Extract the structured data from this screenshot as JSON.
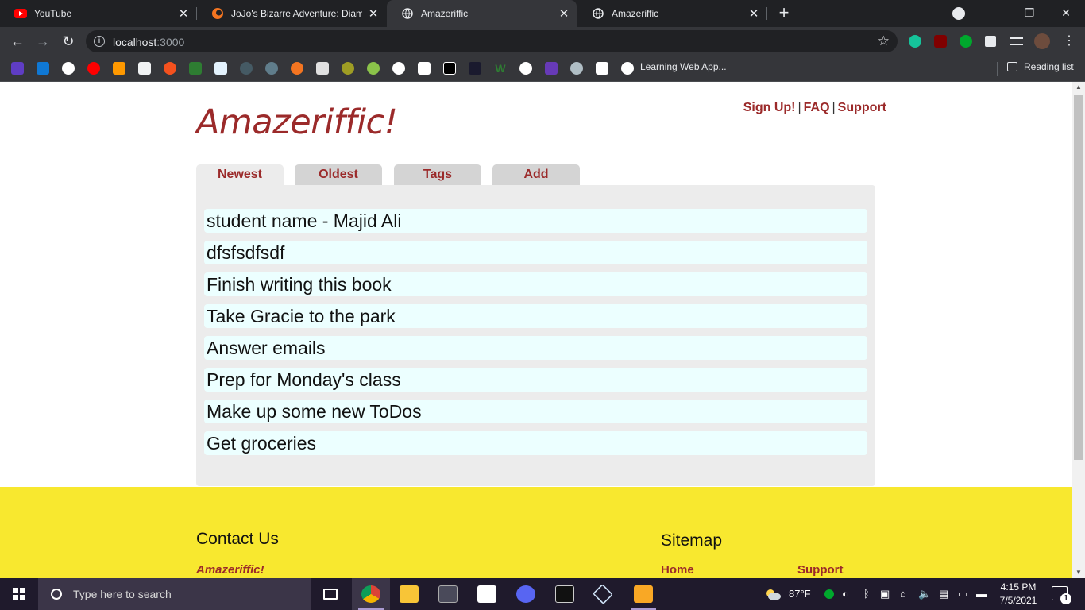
{
  "browser": {
    "tabs": [
      {
        "title": "YouTube",
        "icon": "youtube-icon"
      },
      {
        "title": "JoJo's Bizarre Adventure: Diamond",
        "icon": "crunchyroll-icon"
      },
      {
        "title": "Amazeriffic",
        "icon": "globe-icon",
        "active": true
      },
      {
        "title": "Amazeriffic",
        "icon": "globe-icon"
      }
    ],
    "url_host": "localhost",
    "url_port": ":3000",
    "bookmark_label": "Learning Web App...",
    "reading_list": "Reading list"
  },
  "site": {
    "logo": "Amazeriffic!",
    "links": {
      "signup": "Sign Up!",
      "faq": "FAQ",
      "support": "Support",
      "separator": "|"
    },
    "tabs": [
      "Newest",
      "Oldest",
      "Tags",
      "Add"
    ],
    "active_tab": "Newest",
    "todos": [
      "student name - Majid Ali",
      "dfsfsdfsdf",
      "Finish writing this book",
      "Take Gracie to the park",
      "Answer emails",
      "Prep for Monday's class",
      "Make up some new ToDos",
      "Get groceries"
    ],
    "footer": {
      "contact_heading": "Contact Us",
      "contact_sub": "Amazeriffic!",
      "sitemap_heading": "Sitemap",
      "sitemap_home": "Home",
      "sitemap_support": "Support"
    },
    "colors": {
      "brand": "#9b2a2a",
      "footer_bg": "#f8e82f",
      "panel_bg": "#ececec",
      "todo_bg": "#ecffff"
    }
  },
  "taskbar": {
    "search_placeholder": "Type here to search",
    "weather": "87°F",
    "time": "4:15 PM",
    "date": "7/5/2021",
    "notification_count": "1"
  }
}
